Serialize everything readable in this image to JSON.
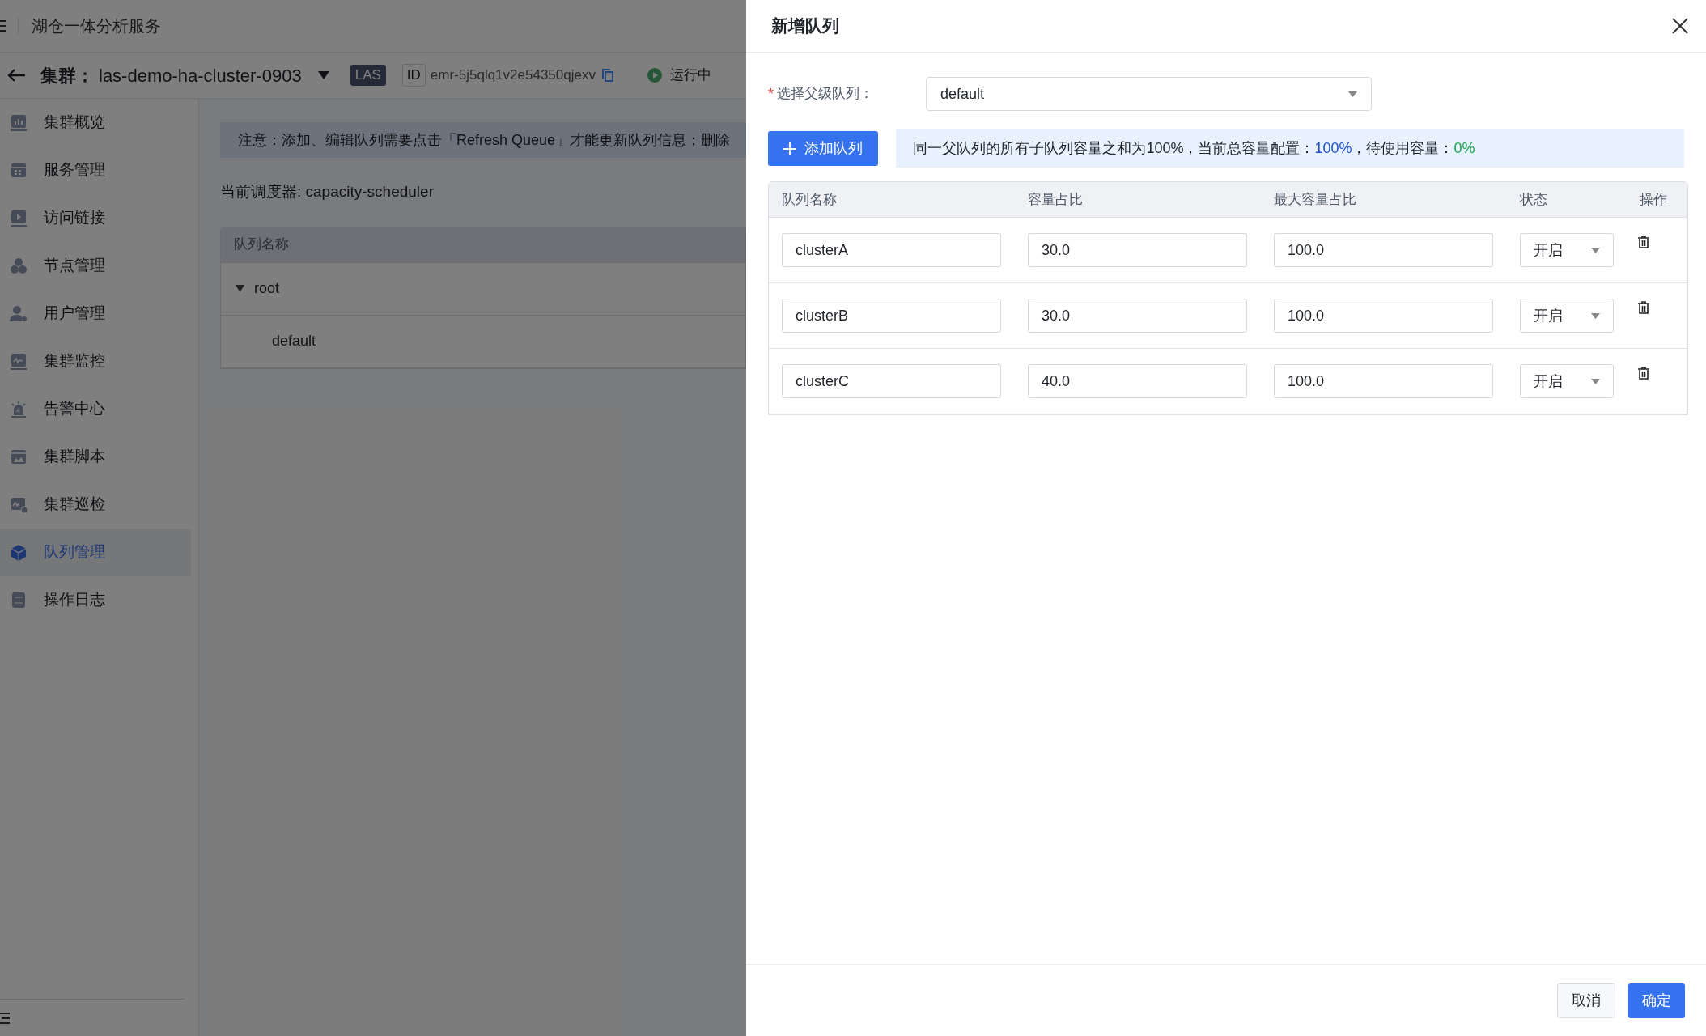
{
  "app_header": {
    "title": "湖仓一体分析服务"
  },
  "cluster_bar": {
    "label": "集群：",
    "name": "las-demo-ha-cluster-0903",
    "tag": "LAS",
    "id_label": "ID",
    "id_value": "emr-5j5qlq1v2e54350qjexv",
    "status": "运行中"
  },
  "sidebar": {
    "items": [
      {
        "label": "集群概览",
        "selected": false
      },
      {
        "label": "服务管理",
        "selected": false
      },
      {
        "label": "访问链接",
        "selected": false
      },
      {
        "label": "节点管理",
        "selected": false
      },
      {
        "label": "用户管理",
        "selected": false
      },
      {
        "label": "集群监控",
        "selected": false
      },
      {
        "label": "告警中心",
        "selected": false
      },
      {
        "label": "集群脚本",
        "selected": false
      },
      {
        "label": "集群巡检",
        "selected": false
      },
      {
        "label": "队列管理",
        "selected": true
      },
      {
        "label": "操作日志",
        "selected": false
      }
    ]
  },
  "main": {
    "notice": "注意：添加、编辑队列需要点击「Refresh Queue」才能更新队列信息；删除",
    "scheduler": "当前调度器: capacity-scheduler",
    "queue_table": {
      "columns": [
        "队列名称"
      ],
      "rows": [
        {
          "name": "root",
          "expanded": true,
          "children": [
            {
              "name": "default"
            }
          ]
        }
      ]
    }
  },
  "drawer": {
    "title": "新增队列",
    "parent_field": {
      "required_mark": "*",
      "label": "选择父级队列：",
      "value": "default"
    },
    "add_button": "添加队列",
    "info": [
      {
        "text": "同一父队列的所有子队列容量之和为100%，当前总容量配置：",
        "color": "#1f2329"
      },
      {
        "text": "100%",
        "color": "#1d4ed8"
      },
      {
        "text": "，待使用容量：",
        "color": "#1f2329"
      },
      {
        "text": "0%",
        "color": "#16a34a"
      }
    ],
    "table": {
      "columns": [
        "队列名称",
        "容量占比",
        "最大容量占比",
        "状态",
        "操作"
      ],
      "rows": [
        {
          "name": "clusterA",
          "capacity": "30.0",
          "max_capacity": "100.0",
          "state": "开启"
        },
        {
          "name": "clusterB",
          "capacity": "30.0",
          "max_capacity": "100.0",
          "state": "开启"
        },
        {
          "name": "clusterC",
          "capacity": "40.0",
          "max_capacity": "100.0",
          "state": "开启"
        }
      ]
    },
    "footer": {
      "cancel": "取消",
      "confirm": "确定"
    }
  }
}
